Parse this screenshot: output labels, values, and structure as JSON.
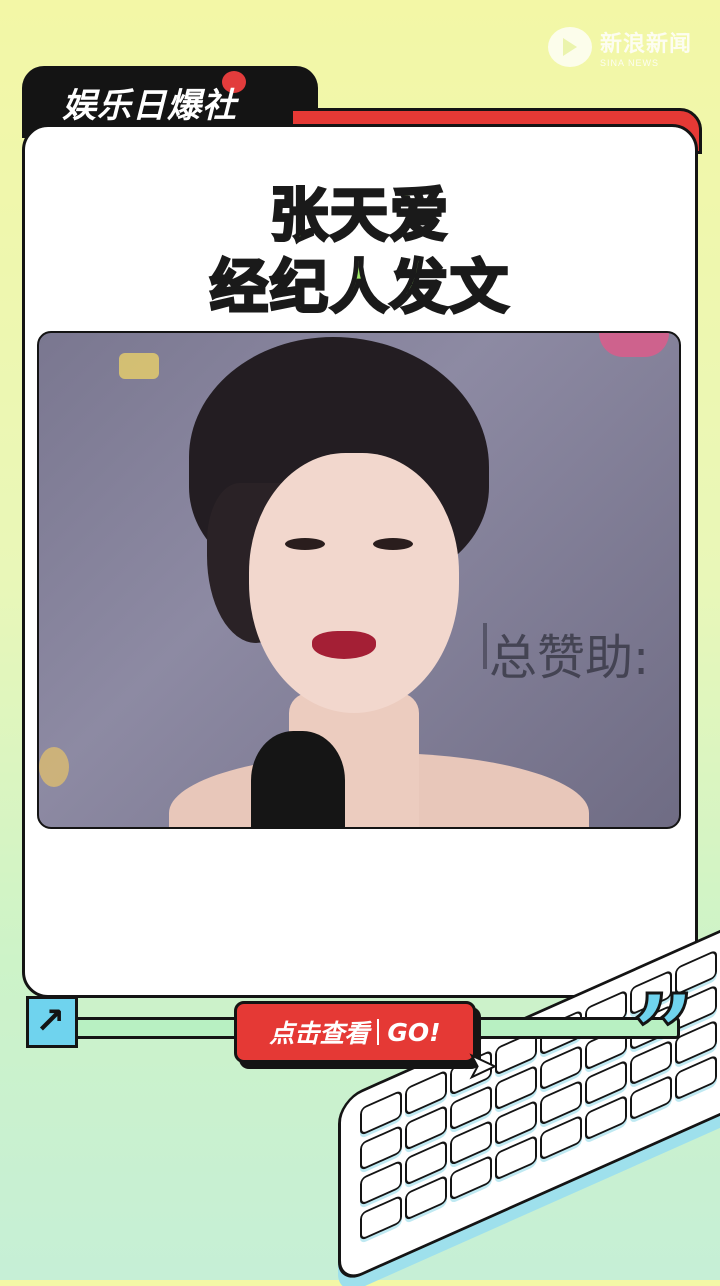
{
  "watermark": {
    "title": "新浪新闻",
    "subtitle": "SINA NEWS"
  },
  "header": {
    "brand": "娱乐日爆社"
  },
  "headline": {
    "line1": "张天爱",
    "line2": "经纪人发文"
  },
  "photo": {
    "background_sign": "总赞助:"
  },
  "cta": {
    "left_label": "点击查看",
    "right_label": "GO!"
  },
  "colors": {
    "accent_red": "#e53935",
    "accent_green": "#9eea67",
    "accent_cyan": "#6fd3ee"
  }
}
